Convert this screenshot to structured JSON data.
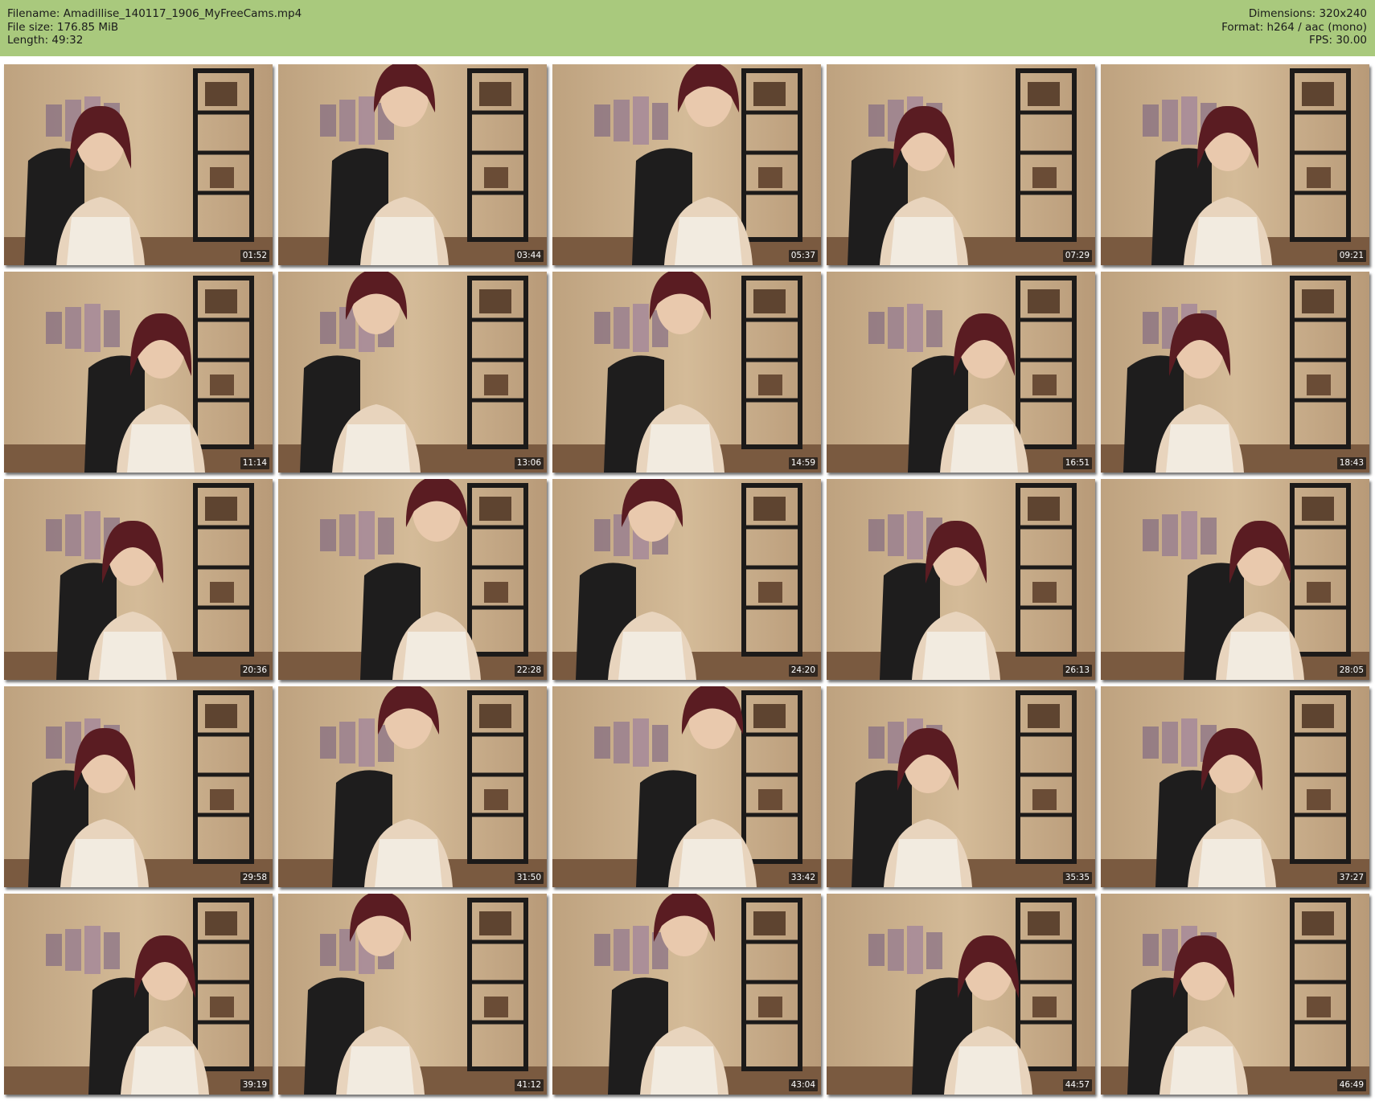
{
  "header": {
    "filename_label": "Filename: Amadillise_140117_1906_MyFreeCams.mp4",
    "filesize_label": "File size: 176.85 MiB",
    "length_label": "Length: 49:32",
    "dimensions_label": "Dimensions: 320x240",
    "format_label": "Format: h264 / aac (mono)",
    "fps_label": "FPS: 30.00",
    "background_color": "#a9c97d"
  },
  "thumbnails": [
    {
      "timestamp": "01:52"
    },
    {
      "timestamp": "03:44"
    },
    {
      "timestamp": "05:37"
    },
    {
      "timestamp": "07:29"
    },
    {
      "timestamp": "09:21"
    },
    {
      "timestamp": "11:14"
    },
    {
      "timestamp": "13:06"
    },
    {
      "timestamp": "14:59"
    },
    {
      "timestamp": "16:51"
    },
    {
      "timestamp": "18:43"
    },
    {
      "timestamp": "20:36"
    },
    {
      "timestamp": "22:28"
    },
    {
      "timestamp": "24:20"
    },
    {
      "timestamp": "26:13"
    },
    {
      "timestamp": "28:05"
    },
    {
      "timestamp": "29:58"
    },
    {
      "timestamp": "31:50"
    },
    {
      "timestamp": "33:42"
    },
    {
      "timestamp": "35:35"
    },
    {
      "timestamp": "37:27"
    },
    {
      "timestamp": "39:19"
    },
    {
      "timestamp": "41:12"
    },
    {
      "timestamp": "43:04"
    },
    {
      "timestamp": "44:57"
    },
    {
      "timestamp": "46:49"
    }
  ]
}
